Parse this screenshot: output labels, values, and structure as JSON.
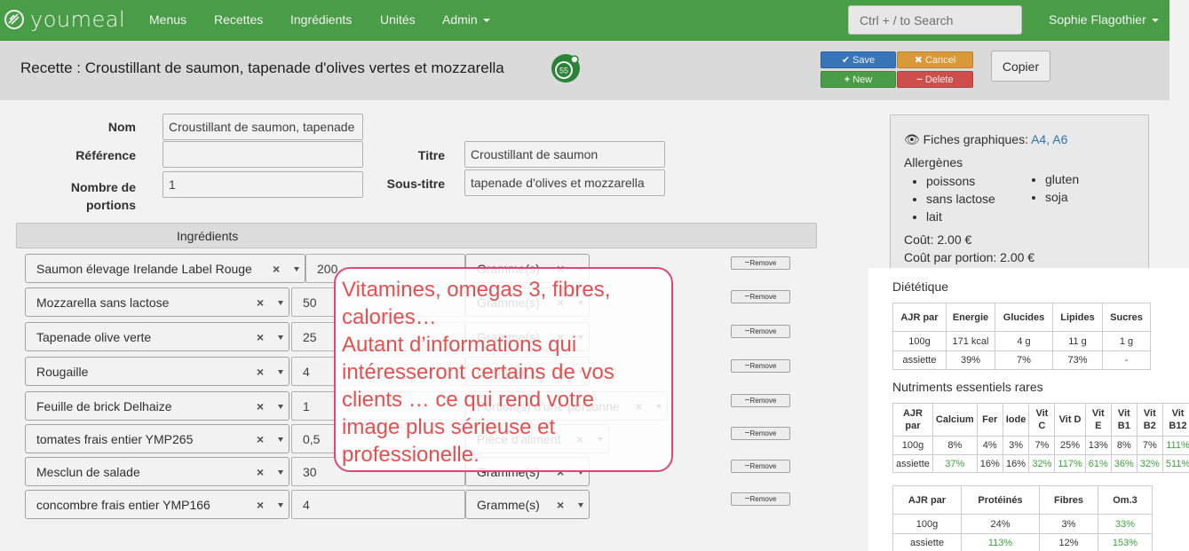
{
  "nav": {
    "brand": "youmeal",
    "links": [
      "Menus",
      "Recettes",
      "Ingrédients",
      "Unités",
      "Admin"
    ],
    "search_placeholder": "Ctrl + / to Search",
    "user": "Sophie Flagothier"
  },
  "header": {
    "title": "Recette : Croustillant de saumon, tapenade d'olives vertes et mozzarella",
    "badge": "55",
    "save": "Save",
    "cancel": "Cancel",
    "new": "New",
    "delete": "Delete",
    "copy": "Copier"
  },
  "form": {
    "nom_label": "Nom",
    "nom_value": "Croustillant de saumon, tapenade",
    "reference_label": "Référence",
    "reference_value": "",
    "titre_label": "Titre",
    "titre_value": "Croustillant de saumon",
    "portions_label_1": "Nombre de",
    "portions_label_2": "portions",
    "portions_value": "1",
    "soustitre_label": "Sous-titre",
    "soustitre_value": "tapenade d'olives et mozzarella"
  },
  "ingredients": {
    "header": "Ingrédients",
    "remove_label": "Remove",
    "rows": [
      {
        "name": "Saumon élevage Irelande Label Rouge",
        "qty": "200",
        "unit": "Gramme(s)"
      },
      {
        "name": "Mozzarella sans lactose",
        "qty": "50",
        "unit": "Gramme(s)"
      },
      {
        "name": "Tapenade olive verte",
        "qty": "25",
        "unit": "Gramme(s)"
      },
      {
        "name": "Rougaille",
        "qty": "4",
        "unit": "Gramme(s)"
      },
      {
        "name": "Feuille de brick Delhaize",
        "qty": "1",
        "unit": "Portion(s) d'une personne"
      },
      {
        "name": "tomates frais entier YMP265",
        "qty": "0,5",
        "unit": "Pièce d'aliment"
      },
      {
        "name": "Mesclun de salade",
        "qty": "30",
        "unit": "Gramme(s)"
      },
      {
        "name": "concombre frais entier YMP166",
        "qty": "4",
        "unit": "Gramme(s)"
      }
    ]
  },
  "side": {
    "fiches_label": "Fiches graphiques:",
    "fiches_a4": "A4",
    "fiches_a6": "A6",
    "allergenes_label": "Allergènes",
    "allergenes_col1": [
      "poissons",
      "sans lactose",
      "lait"
    ],
    "allergenes_col2": [
      "gluten",
      "soja"
    ],
    "cout": "Coût: 2.00 €",
    "cout_portion": "Coût par portion: 2.00 €"
  },
  "dietetique": {
    "title": "Diététique",
    "headers": [
      "AJR par",
      "Energie",
      "Glucides",
      "Lipides",
      "Sucres"
    ],
    "rows": [
      [
        "100g",
        "171 kcal",
        "4 g",
        "11 g",
        "1 g"
      ],
      [
        "assiette",
        "39%",
        "7%",
        "73%",
        "-"
      ]
    ]
  },
  "nutriments": {
    "title": "Nutriments essentiels rares",
    "headers": [
      [
        "AJR",
        "par"
      ],
      [
        "Calcium"
      ],
      [
        "Fer"
      ],
      [
        "Iode"
      ],
      [
        "Vit",
        "C"
      ],
      [
        "Vit D"
      ],
      [
        "Vit",
        "E"
      ],
      [
        "Vit",
        "B1"
      ],
      [
        "Vit",
        "B2"
      ],
      [
        "Vit",
        "B12"
      ]
    ],
    "rows": [
      [
        "100g",
        "8%",
        "4%",
        "3%",
        "7%",
        "25%",
        "13%",
        "8%",
        "7%",
        "111%"
      ],
      [
        "assiette",
        "37%",
        "16%",
        "16%",
        "32%",
        "117%",
        "61%",
        "36%",
        "32%",
        "511%"
      ]
    ],
    "green_row0": [
      9
    ],
    "green_row1": [
      1,
      4,
      5,
      6,
      7,
      8,
      9
    ]
  },
  "proteines": {
    "headers": [
      "AJR par",
      "Protéinés",
      "Fibres",
      "Om.3"
    ],
    "rows": [
      [
        "100g",
        "24%",
        "3%",
        "33%"
      ],
      [
        "assiette",
        "113%",
        "12%",
        "153%"
      ]
    ]
  },
  "callout": {
    "lines": [
      "Vitamines, omegas 3, fibres,",
      "calories…",
      "Autant d’informations qui",
      "intéresseront certains de vos",
      "clients … ce qui rend votre",
      "image plus sérieuse et",
      "professionelle."
    ]
  },
  "colors": {
    "brand_green": "#4ea64b",
    "save_blue": "#3a7bc2",
    "cancel_orange": "#e6a23c",
    "new_green": "#4ea64b",
    "delete_red": "#d9534f",
    "callout_pink": "#e1457a",
    "callout_text": "#e45050",
    "good_value": "#3ea33e"
  }
}
